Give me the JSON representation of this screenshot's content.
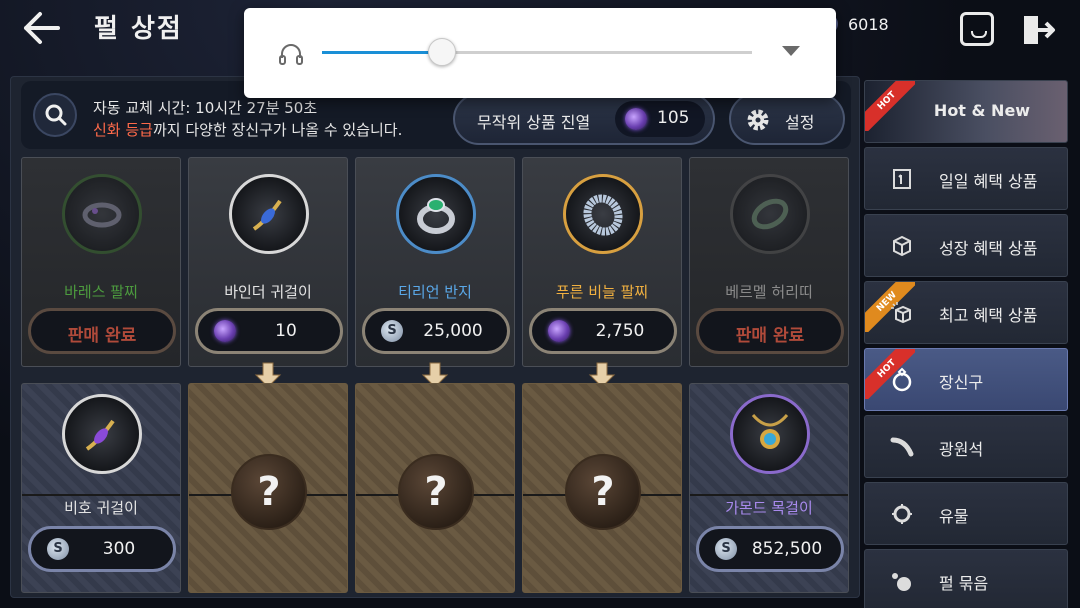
{
  "header": {
    "title": "펄 상점",
    "currency_amount": "6018"
  },
  "volume": {
    "level": 0.28
  },
  "info": {
    "refresh_time": "자동 교체 시간: 10시간 27분 50초",
    "grade_highlight": "신화 등급",
    "grade_note_rest": "까지 다양한 장신구가 나올 수 있습니다.",
    "random_button_label": "무작위 상품 진열",
    "random_cost": "105",
    "settings_label": "설정"
  },
  "top_items": [
    {
      "name": "바레스 팔찌",
      "sold_label": "판매 완료"
    },
    {
      "name": "바인더 귀걸이",
      "price": "10",
      "currency": "pearl"
    },
    {
      "name": "티리언 반지",
      "price": "25,000",
      "currency": "silver"
    },
    {
      "name": "푸른 비늘 팔찌",
      "price": "2,750",
      "currency": "pearl"
    },
    {
      "name": "베르멜 허리띠",
      "sold_label": "판매 완료"
    }
  ],
  "bottom_items": [
    {
      "name": "비호 귀걸이",
      "price": "300",
      "currency": "silver"
    },
    {
      "mystery": "?"
    },
    {
      "mystery": "?"
    },
    {
      "mystery": "?"
    },
    {
      "name": "가몬드 목걸이",
      "price": "852,500",
      "currency": "silver"
    }
  ],
  "silver_symbol": "S",
  "sidebar": {
    "items": [
      {
        "label": "Hot & New",
        "badge": "HOT"
      },
      {
        "label": "일일 혜택 상품"
      },
      {
        "label": "성장 혜택 상품"
      },
      {
        "label": "최고 혜택 상품",
        "badge": "NEW"
      },
      {
        "label": "장신구",
        "badge": "HOT"
      },
      {
        "label": "광원석"
      },
      {
        "label": "유물"
      },
      {
        "label": "펄 묶음"
      }
    ]
  },
  "colors": {
    "mythic_grade": "#ff6a4a",
    "volume_accent": "#1a8fd6",
    "active_tab": "#4a5a86"
  }
}
